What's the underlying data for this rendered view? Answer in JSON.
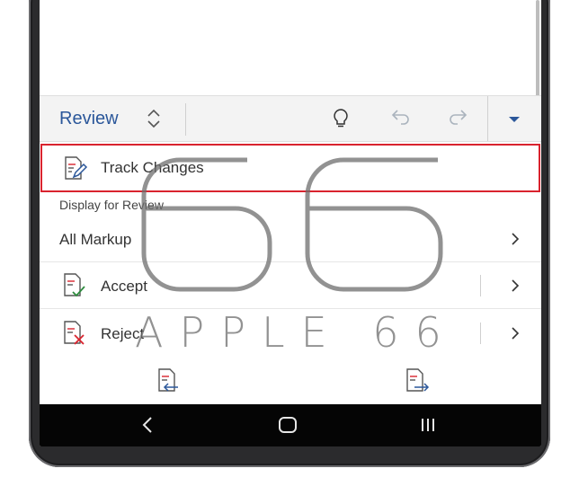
{
  "toolbar": {
    "tab_label": "Review",
    "icons": [
      "tab-chevrons-icon",
      "lightbulb-icon",
      "undo-icon",
      "redo-icon",
      "dropdown-icon"
    ]
  },
  "track_changes": {
    "label": "Track Changes",
    "icon": "track-changes-icon"
  },
  "section": {
    "display_for_review": "Display for Review"
  },
  "items": [
    {
      "label": "All Markup"
    },
    {
      "label": "Accept",
      "icon": "accept-icon"
    },
    {
      "label": "Reject",
      "icon": "reject-icon"
    }
  ],
  "bottom": {
    "icons": [
      "previous-change-icon",
      "next-change-icon"
    ]
  },
  "nav": {
    "icons": [
      "back-icon",
      "home-icon",
      "recents-icon"
    ]
  },
  "watermark": {
    "numeral": "66",
    "text": "APPLE 66"
  },
  "colors": {
    "accent": "#2b579a",
    "highlight": "#d9232e",
    "navbar": "#050505"
  }
}
